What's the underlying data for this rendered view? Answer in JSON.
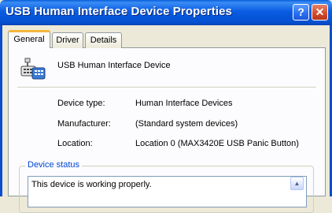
{
  "window": {
    "title": "USB Human Interface Device Properties",
    "help_label": "?",
    "close_label": "✕"
  },
  "tabs": [
    {
      "label": "General",
      "selected": true
    },
    {
      "label": "Driver",
      "selected": false
    },
    {
      "label": "Details",
      "selected": false
    }
  ],
  "device": {
    "icon": "usb-device-icon",
    "name": "USB Human Interface Device"
  },
  "properties": [
    {
      "label": "Device type:",
      "value": "Human Interface Devices"
    },
    {
      "label": "Manufacturer:",
      "value": "(Standard system devices)"
    },
    {
      "label": "Location:",
      "value": "Location 0 (MAX3420E USB Panic Button)"
    }
  ],
  "status": {
    "group_label": "Device status",
    "text": "This device is working properly."
  },
  "colors": {
    "titlebar": "#0a5ce2",
    "accent_label": "#0046d5",
    "tab_highlight": "#f3b63f"
  }
}
